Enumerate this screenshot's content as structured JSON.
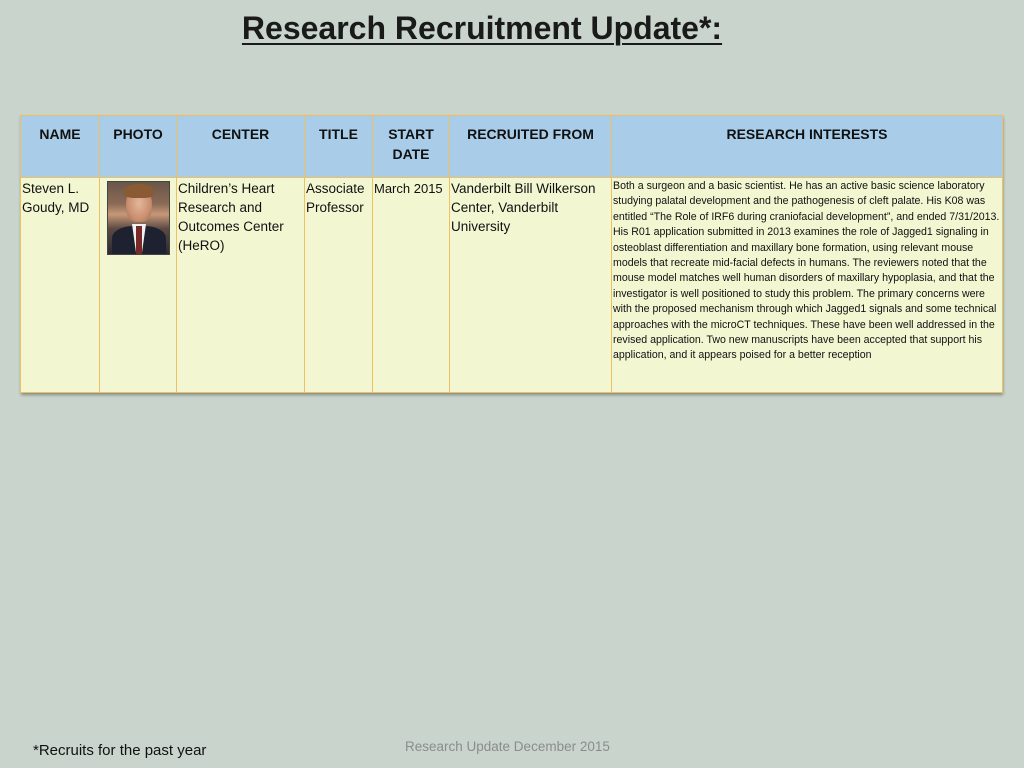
{
  "title": "Research Recruitment Update*:",
  "table": {
    "headers": {
      "name": "NAME",
      "photo": "PHOTO",
      "center": "CENTER",
      "title": "TITLE",
      "start_date": "START DATE",
      "recruited_from": "RECRUITED FROM",
      "research_interests": "RESEARCH INTERESTS"
    },
    "rows": [
      {
        "name": "Steven L. Goudy, MD",
        "photo_icon": "portrait-photo-icon",
        "center": "Children’s Heart Research and Outcomes Center (HeRO)",
        "title": "Associate Professor",
        "start_date": "March 2015",
        "recruited_from": "Vanderbilt Bill Wilkerson Center, Vanderbilt University",
        "research_interests": "Both a surgeon and a basic scientist. He has an active basic science laboratory studying palatal development and the pathogenesis of cleft palate. His K08 was entitled “The Role of IRF6 during craniofacial development”, and ended 7/31/2013. His R01 application submitted in 2013 examines the role of Jagged1 signaling in osteoblast differentiation and maxillary bone formation, using relevant mouse models that recreate mid-facial defects in humans. The reviewers noted that the mouse model matches well human disorders of maxillary hypoplasia, and that the investigator is well positioned to study this problem. The primary concerns were with the proposed mechanism through which Jagged1 signals and some technical approaches with the microCT techniques. These have been well addressed in the revised application. Two new manuscripts have been accepted that support his application, and it appears poised for a better reception"
      }
    ]
  },
  "footnote": "*Recruits for the past year",
  "footer": "Research Update December 2015",
  "colors": {
    "background": "#c8d4cc",
    "header_fill": "#a9cde8",
    "row_fill": "#f2f7d2",
    "border": "#f0c060"
  }
}
